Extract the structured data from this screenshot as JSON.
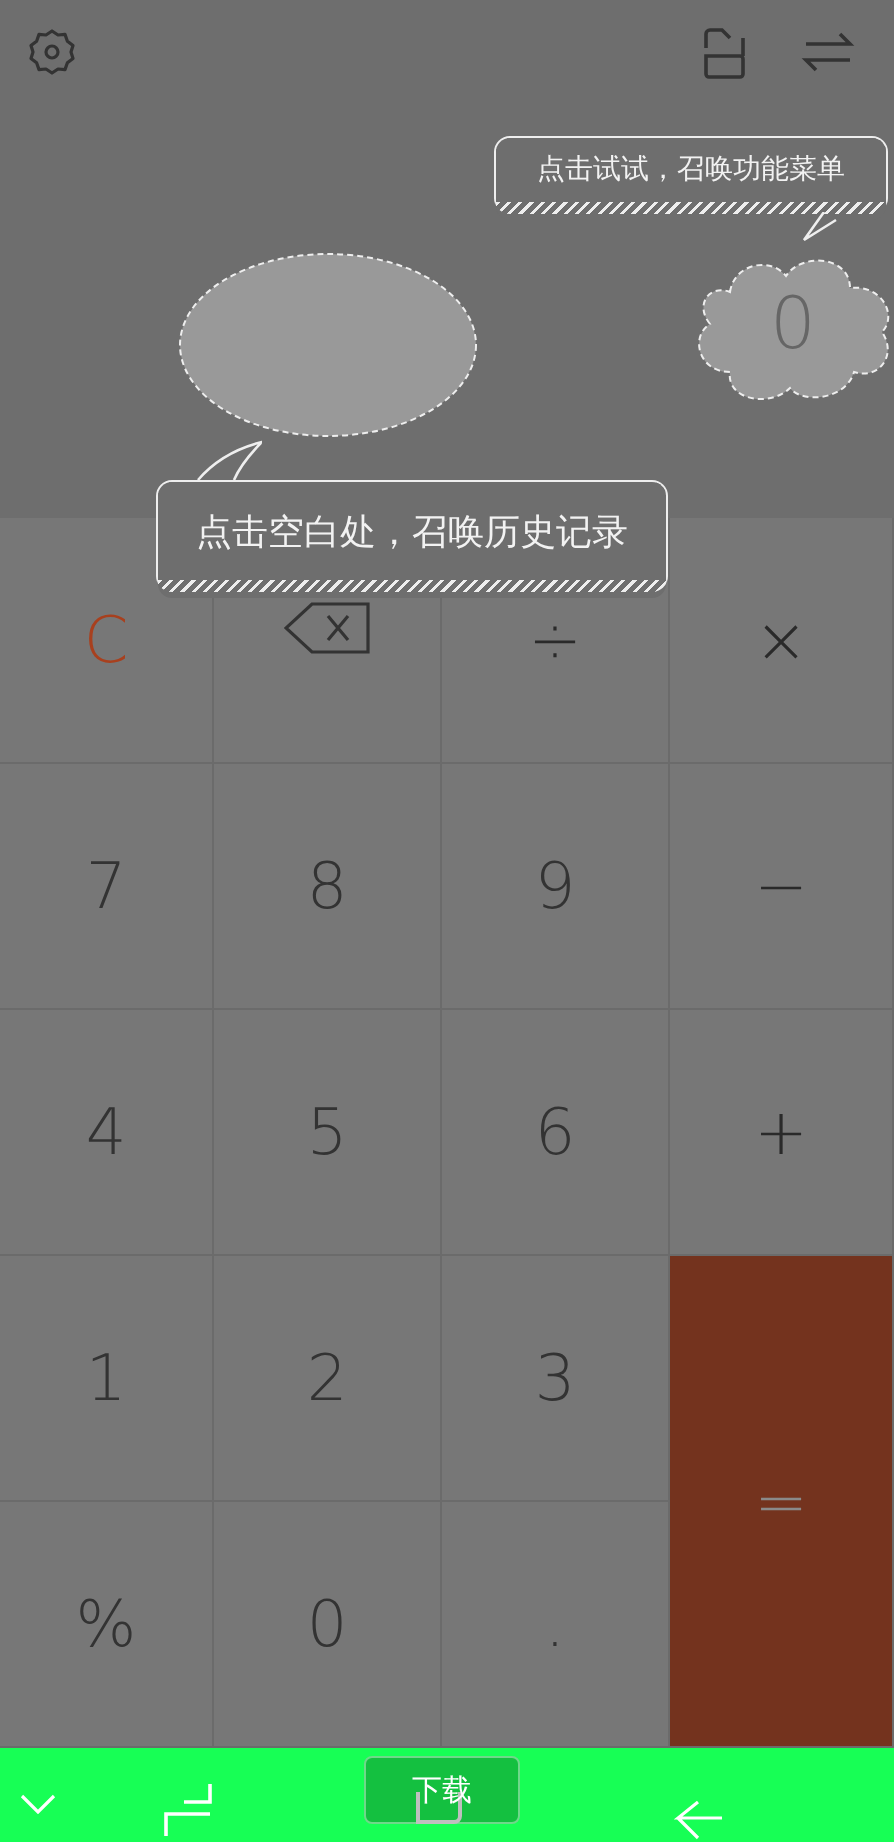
{
  "display": {
    "value": "0"
  },
  "hints": [
    {
      "text": "点击试试，召唤功能菜单"
    },
    {
      "text": "点击空白处，召唤历史记录"
    }
  ],
  "keys": [
    {
      "kind": "clear",
      "label": "C"
    },
    {
      "kind": "backspace"
    },
    {
      "kind": "operator",
      "label": "÷"
    },
    {
      "kind": "operator",
      "label": "×"
    },
    {
      "kind": "digit",
      "label": "7"
    },
    {
      "kind": "digit",
      "label": "8"
    },
    {
      "kind": "digit",
      "label": "9"
    },
    {
      "kind": "operator",
      "label": "−"
    },
    {
      "kind": "digit",
      "label": "4"
    },
    {
      "kind": "digit",
      "label": "5"
    },
    {
      "kind": "digit",
      "label": "6"
    },
    {
      "kind": "operator",
      "label": "+"
    },
    {
      "kind": "digit",
      "label": "1"
    },
    {
      "kind": "digit",
      "label": "2"
    },
    {
      "kind": "digit",
      "label": "3"
    },
    {
      "kind": "equals",
      "label": "="
    },
    {
      "kind": "digit",
      "label": "%"
    },
    {
      "kind": "digit",
      "label": "0"
    },
    {
      "kind": "digit",
      "label": "."
    }
  ],
  "download_button": {
    "label": "下载"
  }
}
